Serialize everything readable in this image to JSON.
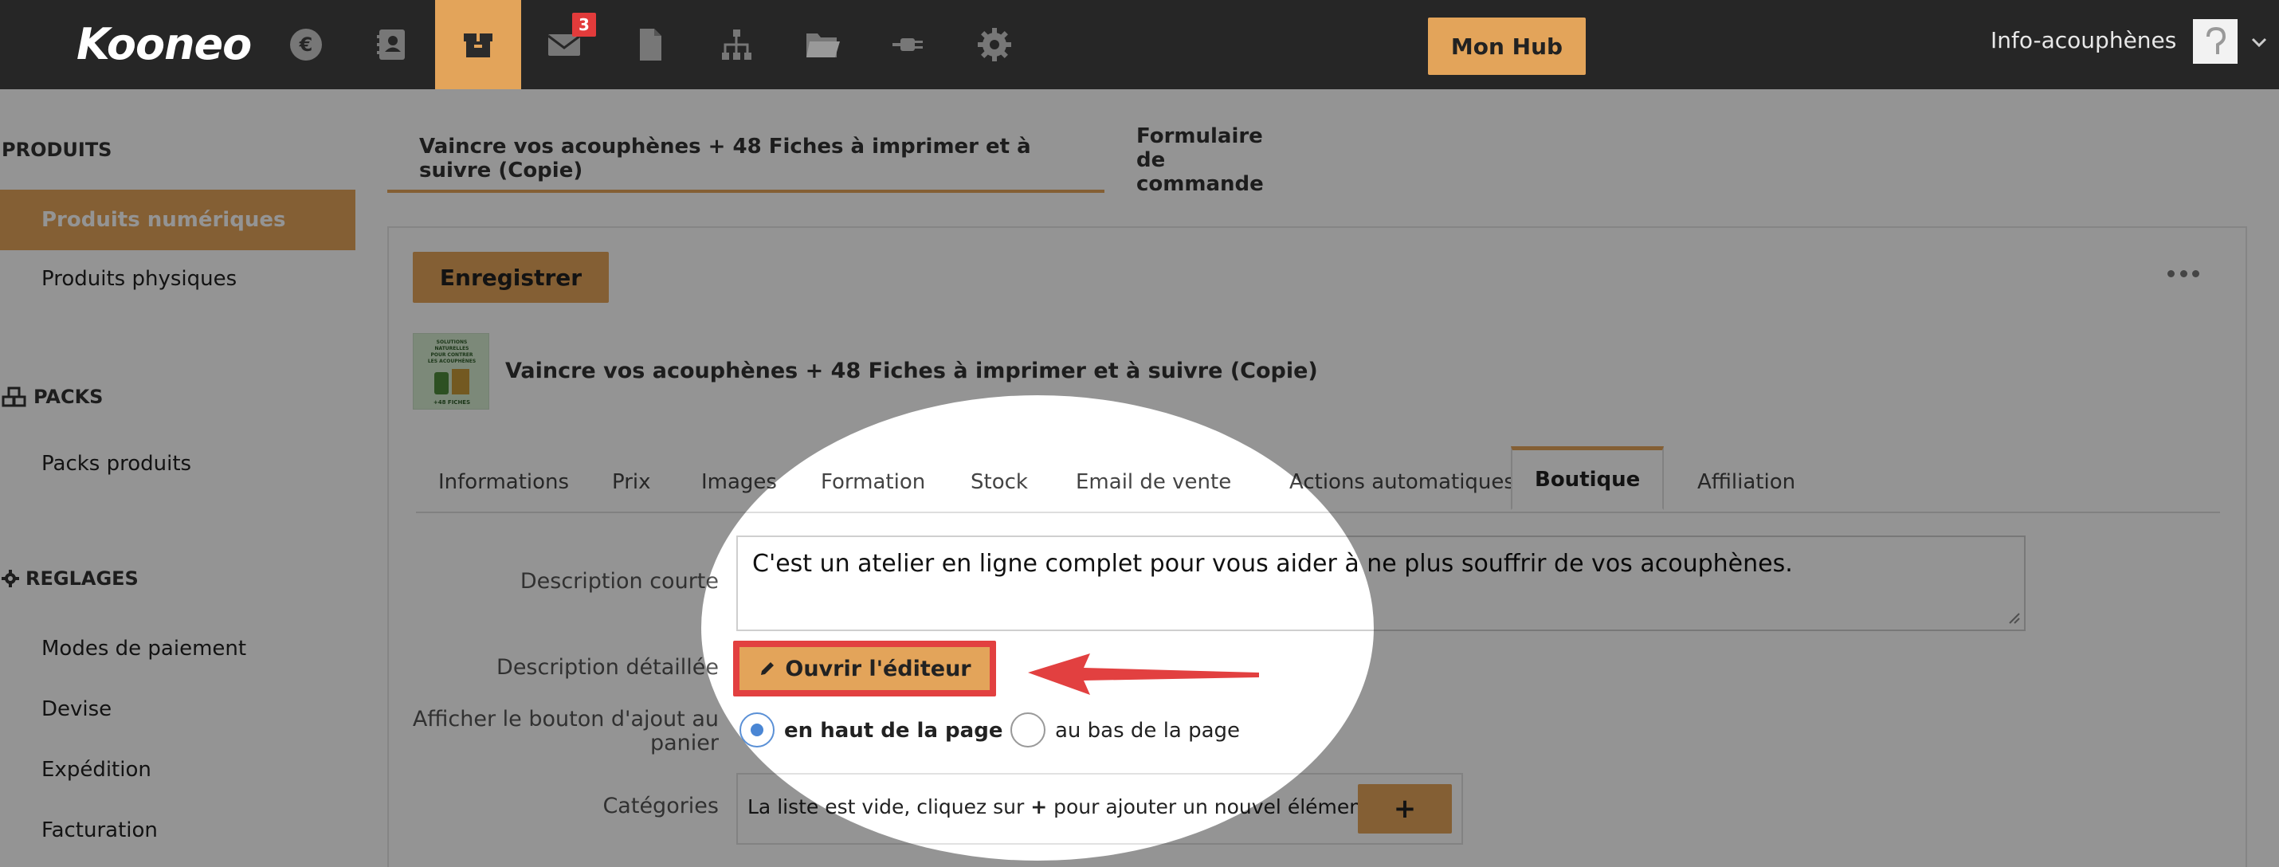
{
  "app": {
    "logo": "Kooneo",
    "nav": [
      {
        "icon": "euro-icon"
      },
      {
        "icon": "contacts-icon"
      },
      {
        "icon": "box-icon"
      },
      {
        "icon": "mail-icon",
        "badge": "3"
      },
      {
        "icon": "document-icon"
      },
      {
        "icon": "sitemap-icon"
      },
      {
        "icon": "folder-icon"
      },
      {
        "icon": "plug-icon"
      },
      {
        "icon": "gear-icon"
      }
    ],
    "hub_button": "Mon Hub",
    "account_name": "Info-acouphènes"
  },
  "sidebar": {
    "sections": [
      {
        "title": "PRODUITS",
        "items": [
          "Produits numériques",
          "Produits physiques"
        ]
      },
      {
        "title": "PACKS",
        "items": [
          "Packs produits"
        ]
      },
      {
        "title": "REGLAGES",
        "items": [
          "Modes de paiement",
          "Devise",
          "Expédition",
          "Facturation"
        ]
      }
    ]
  },
  "page_tabs": [
    "Vaincre vos acouphènes + 48 Fiches à imprimer et à suivre (Copie)",
    "Formulaire de commande"
  ],
  "toolbar": {
    "save_label": "Enregistrer"
  },
  "product": {
    "title": "Vaincre vos acouphènes + 48 Fiches à imprimer et à suivre (Copie)",
    "thumb_text": [
      "SOLUTIONS",
      "NATURELLES",
      "POUR CONTRER",
      "LES ACOUPHÈNES",
      "+48 FICHES"
    ]
  },
  "tabs": [
    "Informations",
    "Prix",
    "Images",
    "Formation",
    "Stock",
    "Email de vente",
    "Actions automatiques",
    "Boutique",
    "Affiliation"
  ],
  "active_tab": "Boutique",
  "form": {
    "short_desc_label": "Description courte",
    "short_desc_value": "C'est un atelier en ligne complet pour vous aider à ne plus souffrir de vos acouphènes.",
    "detailed_desc_label": "Description détaillée",
    "editor_button": "Ouvrir l'éditeur",
    "cart_button_label_1": "Afficher le bouton d'ajout au",
    "cart_button_label_2": "panier",
    "radio_top": "en haut de la page",
    "radio_bottom": "au bas de la page",
    "categories_label": "Catégories",
    "categories_empty_1": "La liste est vide, cliquez sur ",
    "categories_empty_plus": "+",
    "categories_empty_2": " pour ajouter un nouvel élément",
    "categories_add": "+"
  },
  "colors": {
    "accent": "#e3a45a",
    "topbar": "#262626",
    "highlight": "#e24040",
    "radio": "#4a86d4"
  }
}
